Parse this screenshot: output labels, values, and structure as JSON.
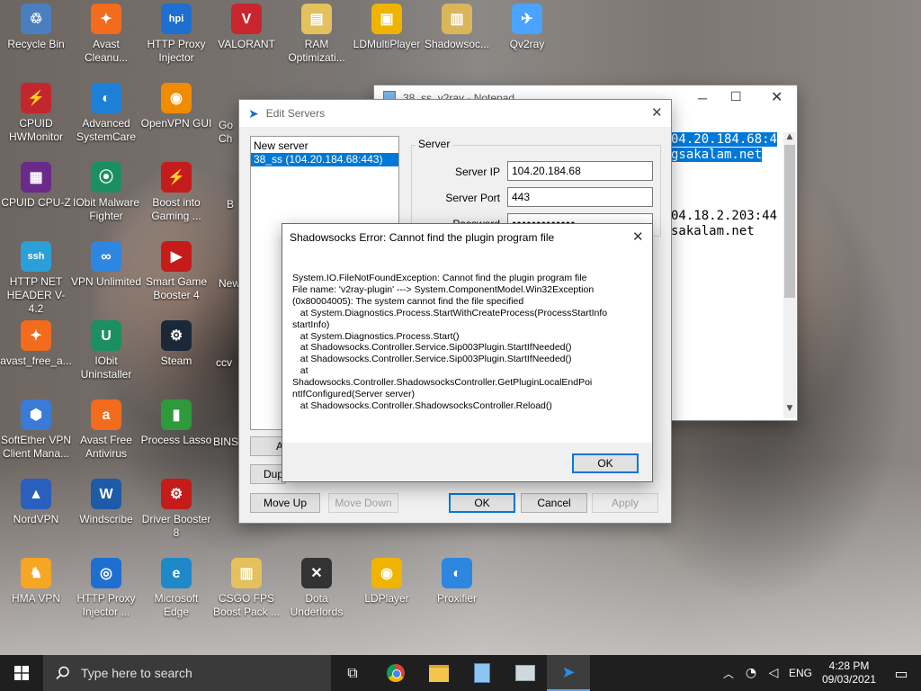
{
  "desktop": {
    "icons": [
      {
        "label": "Recycle Bin",
        "color": "#4a7fbf",
        "glyph": "♲"
      },
      {
        "label": "Avast Cleanu...",
        "color": "#f36b1c",
        "glyph": "✦"
      },
      {
        "label": "HTTP Proxy Injector",
        "color": "#1f6fd1",
        "glyph": "hpi"
      },
      {
        "label": "VALORANT",
        "color": "#c8252f",
        "glyph": "V"
      },
      {
        "label": "RAM Optimizati...",
        "color": "#e4c15c",
        "glyph": "▤"
      },
      {
        "label": "LDMultiPlayer",
        "color": "#f0b400",
        "glyph": "▣"
      },
      {
        "label": "Shadowsoc...",
        "color": "#d9b65c",
        "glyph": "▥"
      },
      {
        "label": "Qv2ray",
        "color": "#4aa3ff",
        "glyph": "✈"
      },
      {
        "label": "CPUID HWMonitor",
        "color": "#c2272d",
        "glyph": "⚡"
      },
      {
        "label": "Advanced SystemCare",
        "color": "#1e7fd6",
        "glyph": "◐"
      },
      {
        "label": "OpenVPN GUI",
        "color": "#f08c00",
        "glyph": "◉"
      },
      {
        "label": "CPUID CPU-Z",
        "color": "#6a2a8a",
        "glyph": "▦"
      },
      {
        "label": "IObit Malware Fighter",
        "color": "#1c8f62",
        "glyph": "⦿"
      },
      {
        "label": "Boost into Gaming ...",
        "color": "#c41b1b",
        "glyph": "⚡"
      },
      {
        "label": "HTTP NET HEADER V-4.2",
        "color": "#2b9fd8",
        "glyph": "ssh"
      },
      {
        "label": "VPN Unlimited",
        "color": "#2d86e0",
        "glyph": "∞"
      },
      {
        "label": "Smart Game Booster 4",
        "color": "#c61b1b",
        "glyph": "▶"
      },
      {
        "label": "avast_free_a...",
        "color": "#f36b1c",
        "glyph": "✦"
      },
      {
        "label": "IObit Uninstaller",
        "color": "#1c8f62",
        "glyph": "U"
      },
      {
        "label": "Steam",
        "color": "#1b2838",
        "glyph": "⚙"
      },
      {
        "label": "SoftEther VPN Client Mana...",
        "color": "#3a7bd5",
        "glyph": "⬢"
      },
      {
        "label": "Avast Free Antivirus",
        "color": "#f36b1c",
        "glyph": "a"
      },
      {
        "label": "Process Lasso",
        "color": "#2e9a3c",
        "glyph": "▮"
      },
      {
        "label": "NordVPN",
        "color": "#2a5fbd",
        "glyph": "▲"
      },
      {
        "label": "Windscribe",
        "color": "#1d5aa8",
        "glyph": "W"
      },
      {
        "label": "Driver Booster 8",
        "color": "#c41b1b",
        "glyph": "⚙"
      },
      {
        "label": "HMA VPN",
        "color": "#f5a623",
        "glyph": "♞"
      },
      {
        "label": "HTTP Proxy Injector ...",
        "color": "#1f6fd1",
        "glyph": "◎"
      },
      {
        "label": "Microsoft Edge",
        "color": "#1e88c8",
        "glyph": "e"
      },
      {
        "label": "CSGO FPS Boost Pack ...",
        "color": "#e4c15c",
        "glyph": "▥"
      },
      {
        "label": "Dota Underlords",
        "color": "#333333",
        "glyph": "✕"
      },
      {
        "label": "LDPlayer",
        "color": "#f0b400",
        "glyph": "◉"
      },
      {
        "label": "Proxifier",
        "color": "#2d86e0",
        "glyph": "◐"
      }
    ],
    "partial_labels": [
      "Go",
      "Ch",
      "B",
      "New",
      "ccv",
      "BINS"
    ]
  },
  "notepad": {
    "title": "38_ss_v2ray - Notepad",
    "lines": [
      "04.20.184.68:4",
      "gsakalam.net",
      "",
      "",
      "",
      "04.18.2.203:44",
      "sakalam.net"
    ]
  },
  "edit_servers": {
    "title": "Edit Servers",
    "servers": [
      "New server",
      "38_ss (104.20.184.68:443)"
    ],
    "group_label": "Server",
    "server_ip_label": "Server IP",
    "server_ip_value": "104.20.184.68",
    "server_port_label": "Server Port",
    "server_port_value": "443",
    "password_label": "Password",
    "password_value": "●●●●●●●●●●●●●",
    "buttons": {
      "add": "A",
      "duplicate": "Dup",
      "move_up": "Move Up",
      "move_down": "Move Down",
      "ok": "OK",
      "cancel": "Cancel",
      "apply": "Apply"
    }
  },
  "error_dialog": {
    "title": "Shadowsocks Error: Cannot find the plugin program file",
    "message_lines": [
      "System.IO.FileNotFoundException: Cannot find the plugin program file",
      "File name: 'v2ray-plugin' ---> System.ComponentModel.Win32Exception",
      "(0x80004005): The system cannot find the file specified",
      "   at System.Diagnostics.Process.StartWithCreateProcess(ProcessStartInfo",
      "startInfo)",
      "   at System.Diagnostics.Process.Start()",
      "   at Shadowsocks.Controller.Service.Sip003Plugin.StartIfNeeded()",
      "   at Shadowsocks.Controller.Service.Sip003Plugin.StartIfNeeded()",
      "   at",
      "Shadowsocks.Controller.ShadowsocksController.GetPluginLocalEndPoi",
      "ntIfConfigured(Server server)",
      "   at Shadowsocks.Controller.ShadowsocksController.Reload()"
    ],
    "ok_label": "OK"
  },
  "taskbar": {
    "search_placeholder": "Type here to search",
    "language": "ENG",
    "time": "4:28 PM",
    "date": "09/03/2021"
  },
  "colors": {
    "accent": "#0078d7",
    "taskbar": "#1f1f1f",
    "selection": "#0078d7"
  }
}
